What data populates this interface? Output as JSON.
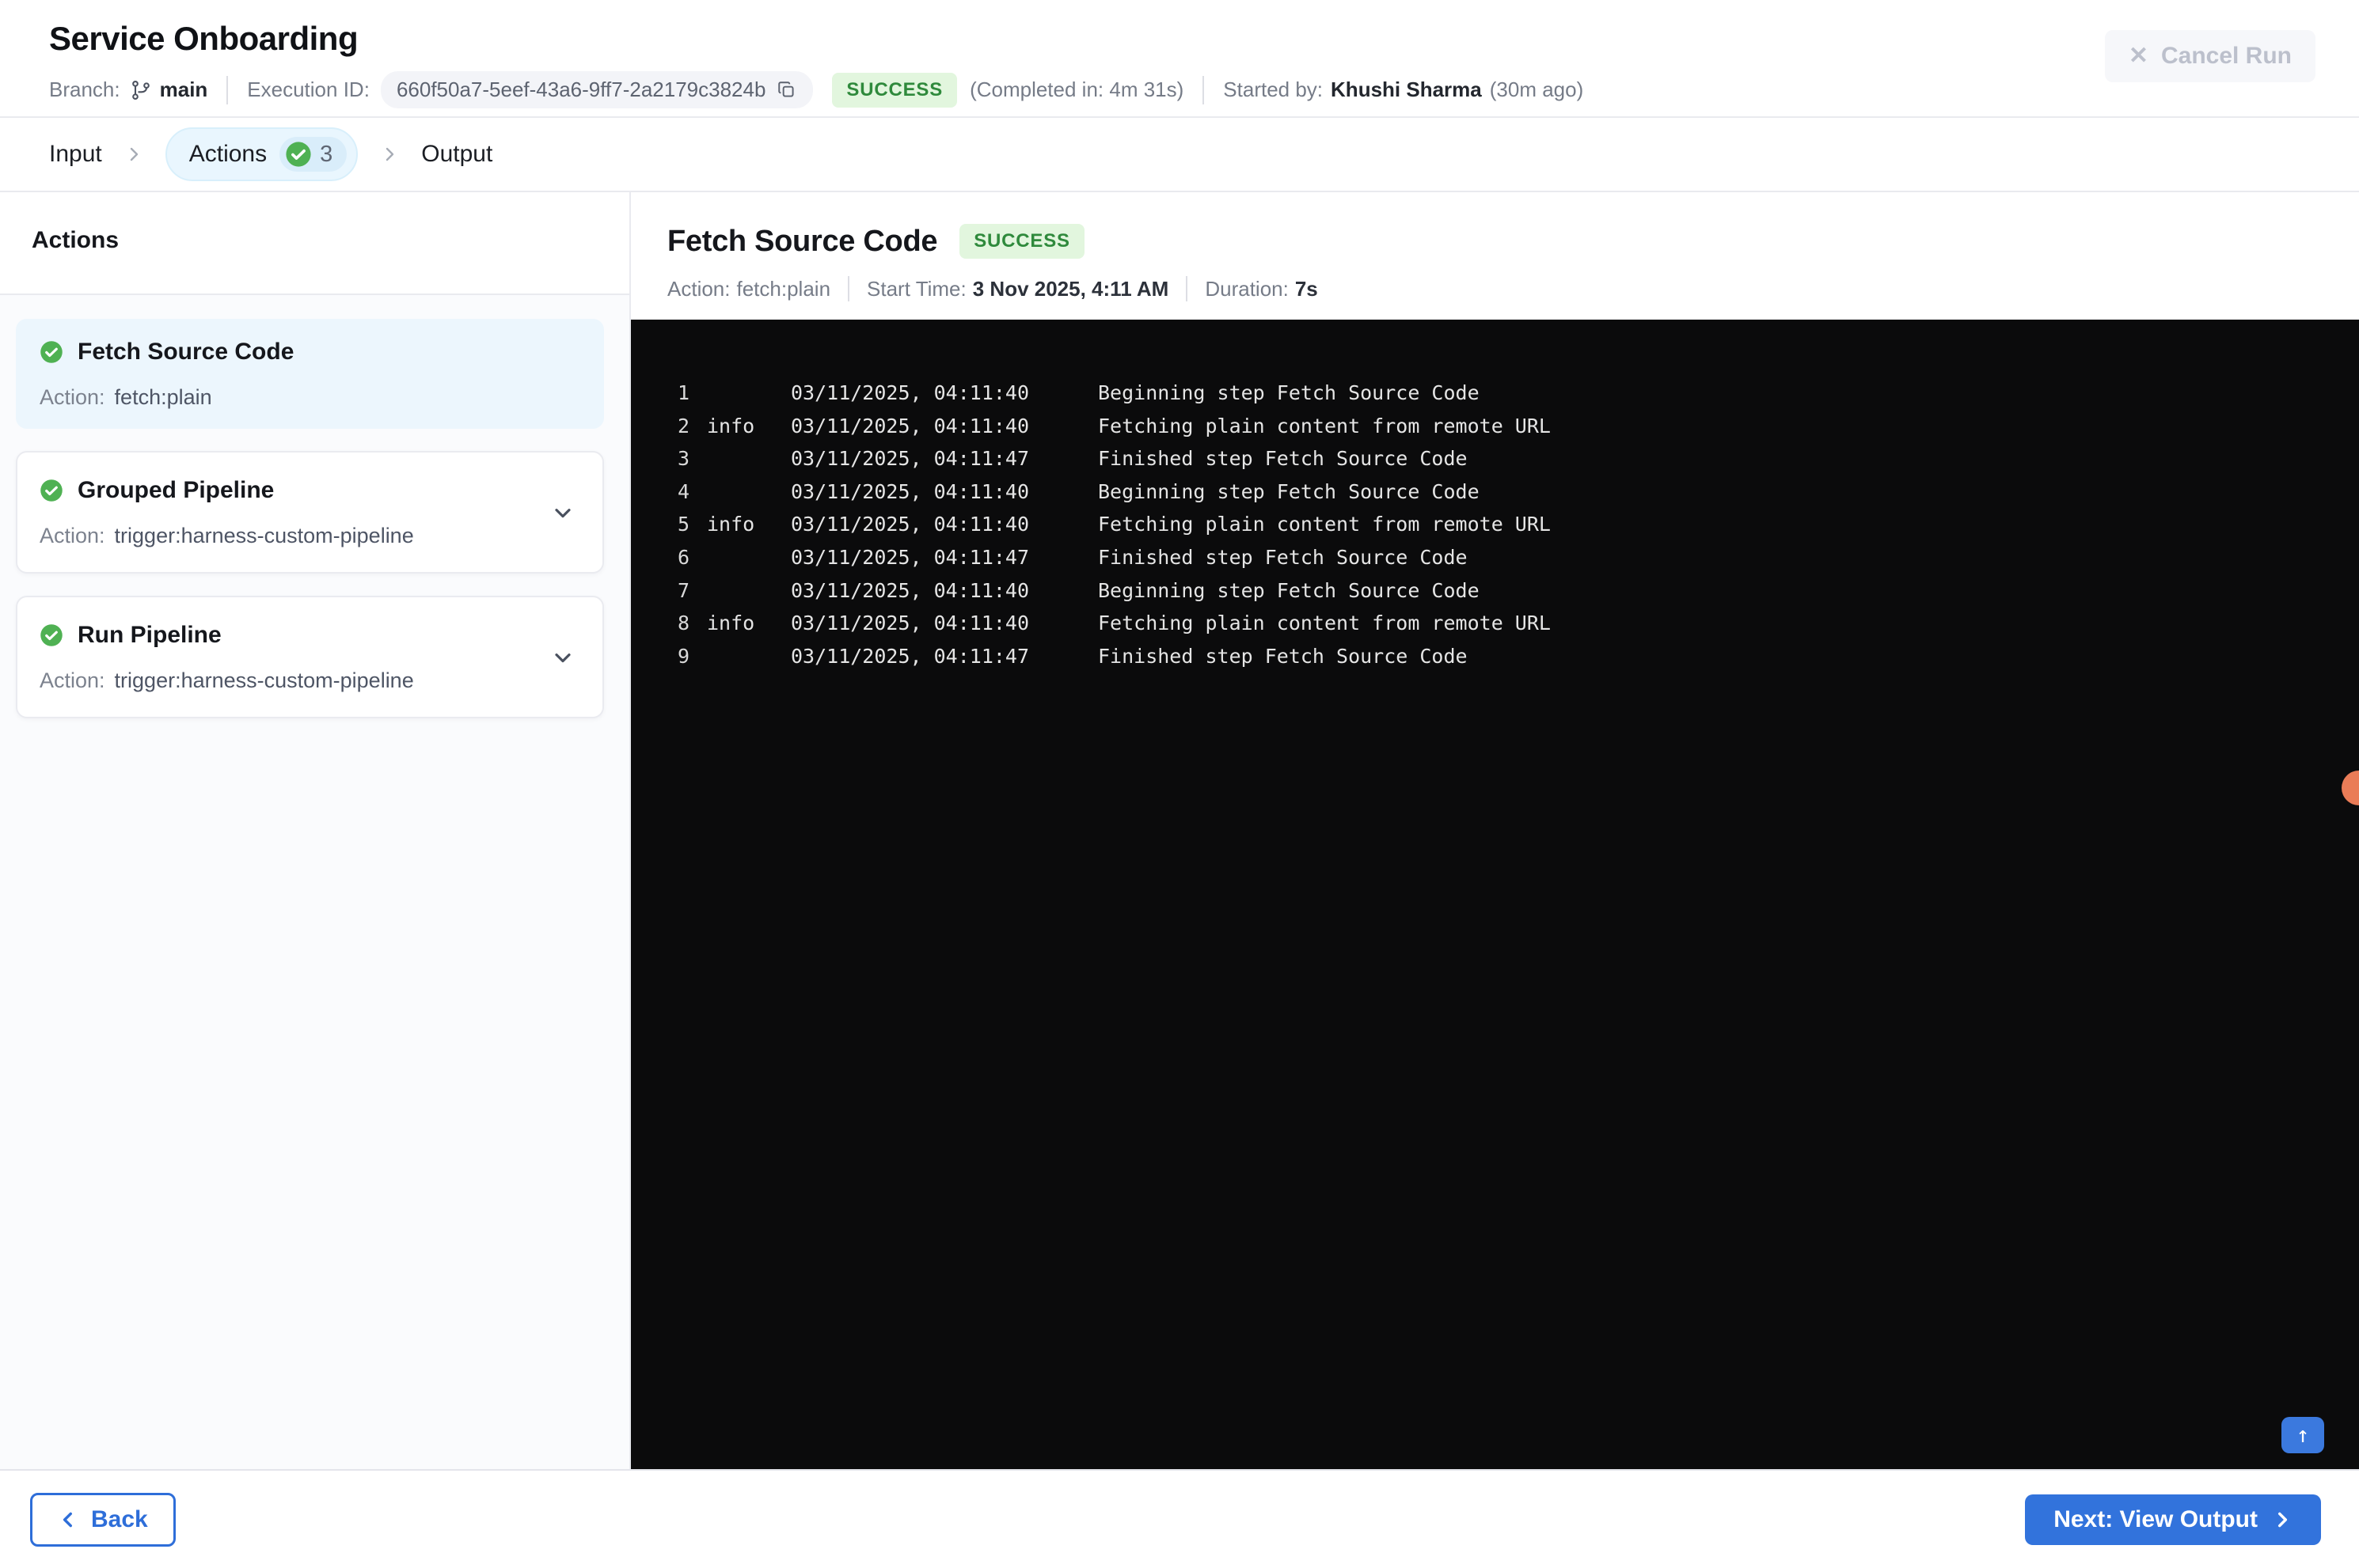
{
  "header": {
    "title": "Service Onboarding",
    "branch_label": "Branch:",
    "branch_name": "main",
    "execution_id_label": "Execution ID:",
    "execution_id": "660f50a7-5eef-43a6-9ff7-2a2179c3824b",
    "status": "SUCCESS",
    "completed_in": "(Completed in: 4m 31s)",
    "started_by_label": "Started by:",
    "started_by": "Khushi Sharma",
    "started_ago": "(30m ago)",
    "cancel_label": "Cancel Run"
  },
  "tabs": {
    "input": "Input",
    "actions": "Actions",
    "actions_count": "3",
    "output": "Output"
  },
  "sidebar": {
    "heading": "Actions",
    "action_label": "Action:",
    "items": [
      {
        "title": "Fetch Source Code",
        "action": "fetch:plain",
        "selected": true,
        "expandable": false
      },
      {
        "title": "Grouped Pipeline",
        "action": "trigger:harness-custom-pipeline",
        "selected": false,
        "expandable": true
      },
      {
        "title": "Run Pipeline",
        "action": "trigger:harness-custom-pipeline",
        "selected": false,
        "expandable": true
      }
    ]
  },
  "step": {
    "title": "Fetch Source Code",
    "status": "SUCCESS",
    "action_label": "Action:",
    "action_value": "fetch:plain",
    "start_label": "Start Time:",
    "start_value": "3 Nov 2025, 4:11 AM",
    "duration_label": "Duration:",
    "duration_value": "7s"
  },
  "log": {
    "lines": [
      {
        "num": "1",
        "level": "",
        "time": "03/11/2025, 04:11:40",
        "msg": "Beginning step Fetch Source Code"
      },
      {
        "num": "2",
        "level": "info",
        "time": "03/11/2025, 04:11:40",
        "msg": "Fetching plain content from remote URL"
      },
      {
        "num": "3",
        "level": "",
        "time": "03/11/2025, 04:11:47",
        "msg": "Finished step Fetch Source Code"
      },
      {
        "num": "4",
        "level": "",
        "time": "03/11/2025, 04:11:40",
        "msg": "Beginning step Fetch Source Code"
      },
      {
        "num": "5",
        "level": "info",
        "time": "03/11/2025, 04:11:40",
        "msg": "Fetching plain content from remote URL"
      },
      {
        "num": "6",
        "level": "",
        "time": "03/11/2025, 04:11:47",
        "msg": "Finished step Fetch Source Code"
      },
      {
        "num": "7",
        "level": "",
        "time": "03/11/2025, 04:11:40",
        "msg": "Beginning step Fetch Source Code"
      },
      {
        "num": "8",
        "level": "info",
        "time": "03/11/2025, 04:11:40",
        "msg": "Fetching plain content from remote URL"
      },
      {
        "num": "9",
        "level": "",
        "time": "03/11/2025, 04:11:47",
        "msg": "Finished step Fetch Source Code"
      }
    ]
  },
  "footer": {
    "back_label": "Back",
    "next_label": "Next: View Output"
  },
  "colors": {
    "accent_blue": "#2e6ed9",
    "success_bg": "#e2f6de",
    "success_text": "#2f8a3c",
    "check_green": "#4fb153",
    "console_bg": "#0b0b0c",
    "selected_card_bg": "#ecf6fd",
    "active_tab_bg": "#e9f6fe",
    "orange_marker": "#ea7c57"
  }
}
